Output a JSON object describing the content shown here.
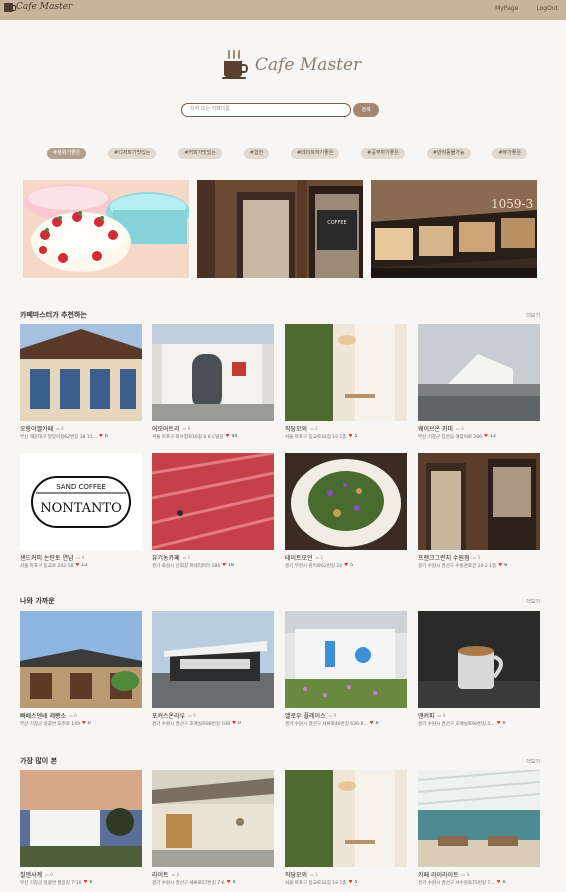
{
  "header": {
    "brand": "Cafe Master",
    "nav": [
      "MyPage",
      "LogOut"
    ]
  },
  "logo": {
    "text": "Cafe Master"
  },
  "search": {
    "placeholder": "지역 또는 카페이름",
    "button": "검색"
  },
  "tags": [
    "#분위기좋은",
    "#디저트가맛있는",
    "#커피가맛있는",
    "#힙한",
    "#데이트하기좋은",
    "#공부하기좋은",
    "#반려동물가능",
    "#뷰가좋은"
  ],
  "colors": {
    "header": "#c9b49b",
    "accent": "#a48673",
    "heart": "#dd3333",
    "background": "#f8f6f2"
  },
  "sections": [
    {
      "title": "카페마스터가 추천하는",
      "more": "더보기",
      "cards": [
        {
          "name": "오랑이옐카페",
          "reviews": "6",
          "addr": "부산 해운대구 달맞이길62번길 38 11...",
          "likes": "6"
        },
        {
          "name": "어모어트리",
          "reviews": "9",
          "addr": "서울 마포구 희우정로16길 8 K.C빌딩",
          "likes": "44"
        },
        {
          "name": "작당모의",
          "reviews": "2",
          "addr": "서울 마포구 동교로32길 19 1층",
          "likes": "5"
        },
        {
          "name": "웨이브온 커피",
          "reviews": "3",
          "addr": "부산 기장군 장안읍 해맞이로 286",
          "likes": "13"
        },
        {
          "name": "샌드커피 논탄토 연남",
          "reviews": "4",
          "addr": "서울 마포구 동교로 242-16",
          "likes": "13"
        },
        {
          "name": "유기농카페",
          "reviews": "1",
          "addr": "경기 화성시 신외길 파네리마리 184",
          "likes": "18"
        },
        {
          "name": "테이트모던",
          "reviews": "1",
          "addr": "경기 부천시 원미로62번길 24",
          "likes": "5"
        },
        {
          "name": "프렌크그런지 수원점",
          "reviews": "5",
          "addr": "경기 수원시 권선구 수원천로건 24-2 1층",
          "likes": "8"
        }
      ]
    },
    {
      "title": "나와 가까운",
      "more": "더보기",
      "cards": [
        {
          "name": "빠베스덴테 제빵소",
          "reviews": "0",
          "addr": "부산 기장군 일광면 도주로 149",
          "likes": "0"
        },
        {
          "name": "포커스온라우",
          "reviews": "0",
          "addr": "경기 수원시 권선구 호매실로88번길 108",
          "likes": "0"
        },
        {
          "name": "앨로우 플레이스",
          "reviews": "0",
          "addr": "경기 수원시 권선구 세류로46번길 636-8...",
          "likes": "0"
        },
        {
          "name": "앤커피",
          "reviews": "0",
          "addr": "경기 수원시 권선구 호매실로90번길 5...",
          "likes": "0"
        }
      ]
    },
    {
      "title": "가장 많이 본",
      "more": "더보기",
      "cards": [
        {
          "name": "칠앤사계",
          "reviews": "0",
          "addr": "부산 기장군 일광면 칠암길 7-10",
          "likes": "6"
        },
        {
          "name": "라이트",
          "reviews": "0",
          "addr": "경기 수원시 권선구 세류로57번길 7-6",
          "likes": "0"
        },
        {
          "name": "작당모의",
          "reviews": "1",
          "addr": "서울 마포구 동교로32길 19 1층",
          "likes": "5"
        },
        {
          "name": "카페 라이라이트",
          "reviews": "0",
          "addr": "경기 수원시 권선구 서수원로75번길 7...",
          "likes": "0"
        }
      ]
    }
  ],
  "banner_texts": {
    "nontanto_top": "SAND COFFEE",
    "nontanto_main": "NONTANTO",
    "cafe_sign": "1059-3"
  }
}
